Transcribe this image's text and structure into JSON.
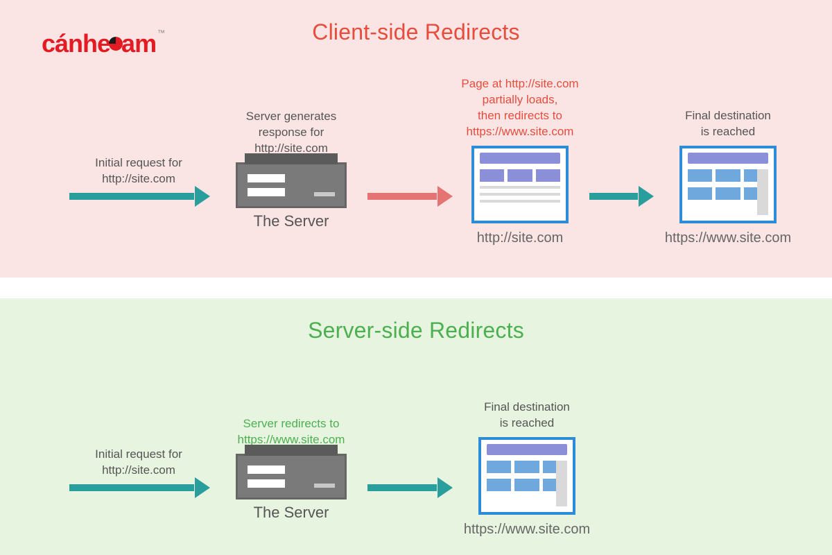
{
  "logo": {
    "text": "cánhe",
    "text2": "am",
    "tm": "™"
  },
  "top": {
    "title": "Client-side Redirects",
    "step1_above": "Initial request for\nhttp://site.com",
    "server_above": "Server generates\nresponse for\nhttp://site.com",
    "server_label": "The Server",
    "partial_above": "Page at http://site.com\npartially loads,\nthen redirects to\nhttps://www.site.com",
    "partial_caption": "http://site.com",
    "final_above": "Final destination\nis reached",
    "final_caption": "https://www.site.com"
  },
  "bottom": {
    "title": "Server-side Redirects",
    "step1_above": "Initial request for\nhttp://site.com",
    "server_above": "Server redirects to\nhttps://www.site.com",
    "server_label": "The Server",
    "final_above": "Final destination\nis reached",
    "final_caption": "https://www.site.com"
  }
}
